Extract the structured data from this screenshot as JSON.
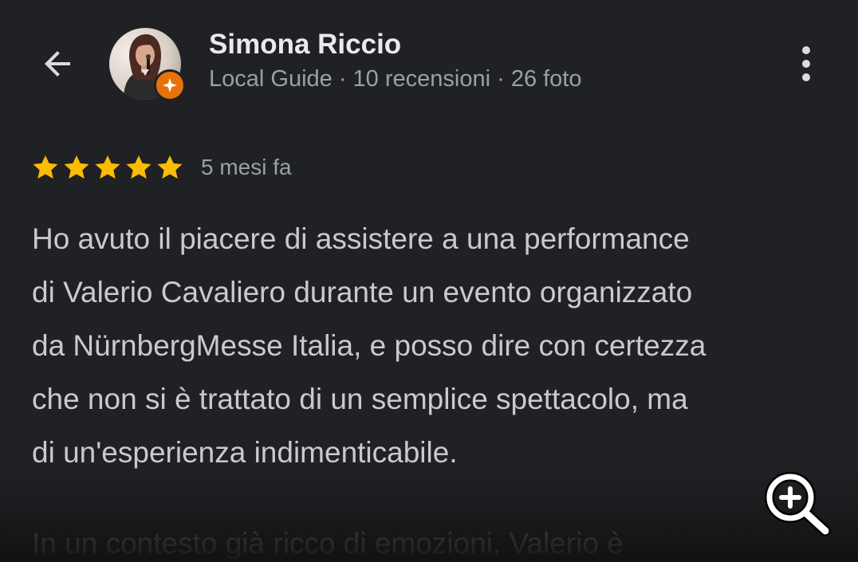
{
  "header": {
    "back_icon": "arrow-back-icon",
    "user_name": "Simona Riccio",
    "user_meta": "Local Guide · 10 recensioni · 26 foto",
    "badge_icon": "local-guide-star-icon",
    "badge_color": "#e8710a",
    "more_icon": "more-vert-icon"
  },
  "review": {
    "rating": 5,
    "max_rating": 5,
    "star_color": "#fbbc04",
    "date": "5 mesi fa",
    "lines": [
      "Ho avuto il piacere di assistere a una performance",
      "di Valerio Cavaliero durante un evento organizzato",
      "da NürnbergMesse Italia, e posso dire con certezza",
      "che non si è trattato di un semplice spettacolo, ma",
      "di un'esperienza indimenticabile."
    ],
    "continued": "In un contesto già ricco di emozioni, Valerio è"
  },
  "zoom": {
    "icon": "zoom-in-icon"
  }
}
